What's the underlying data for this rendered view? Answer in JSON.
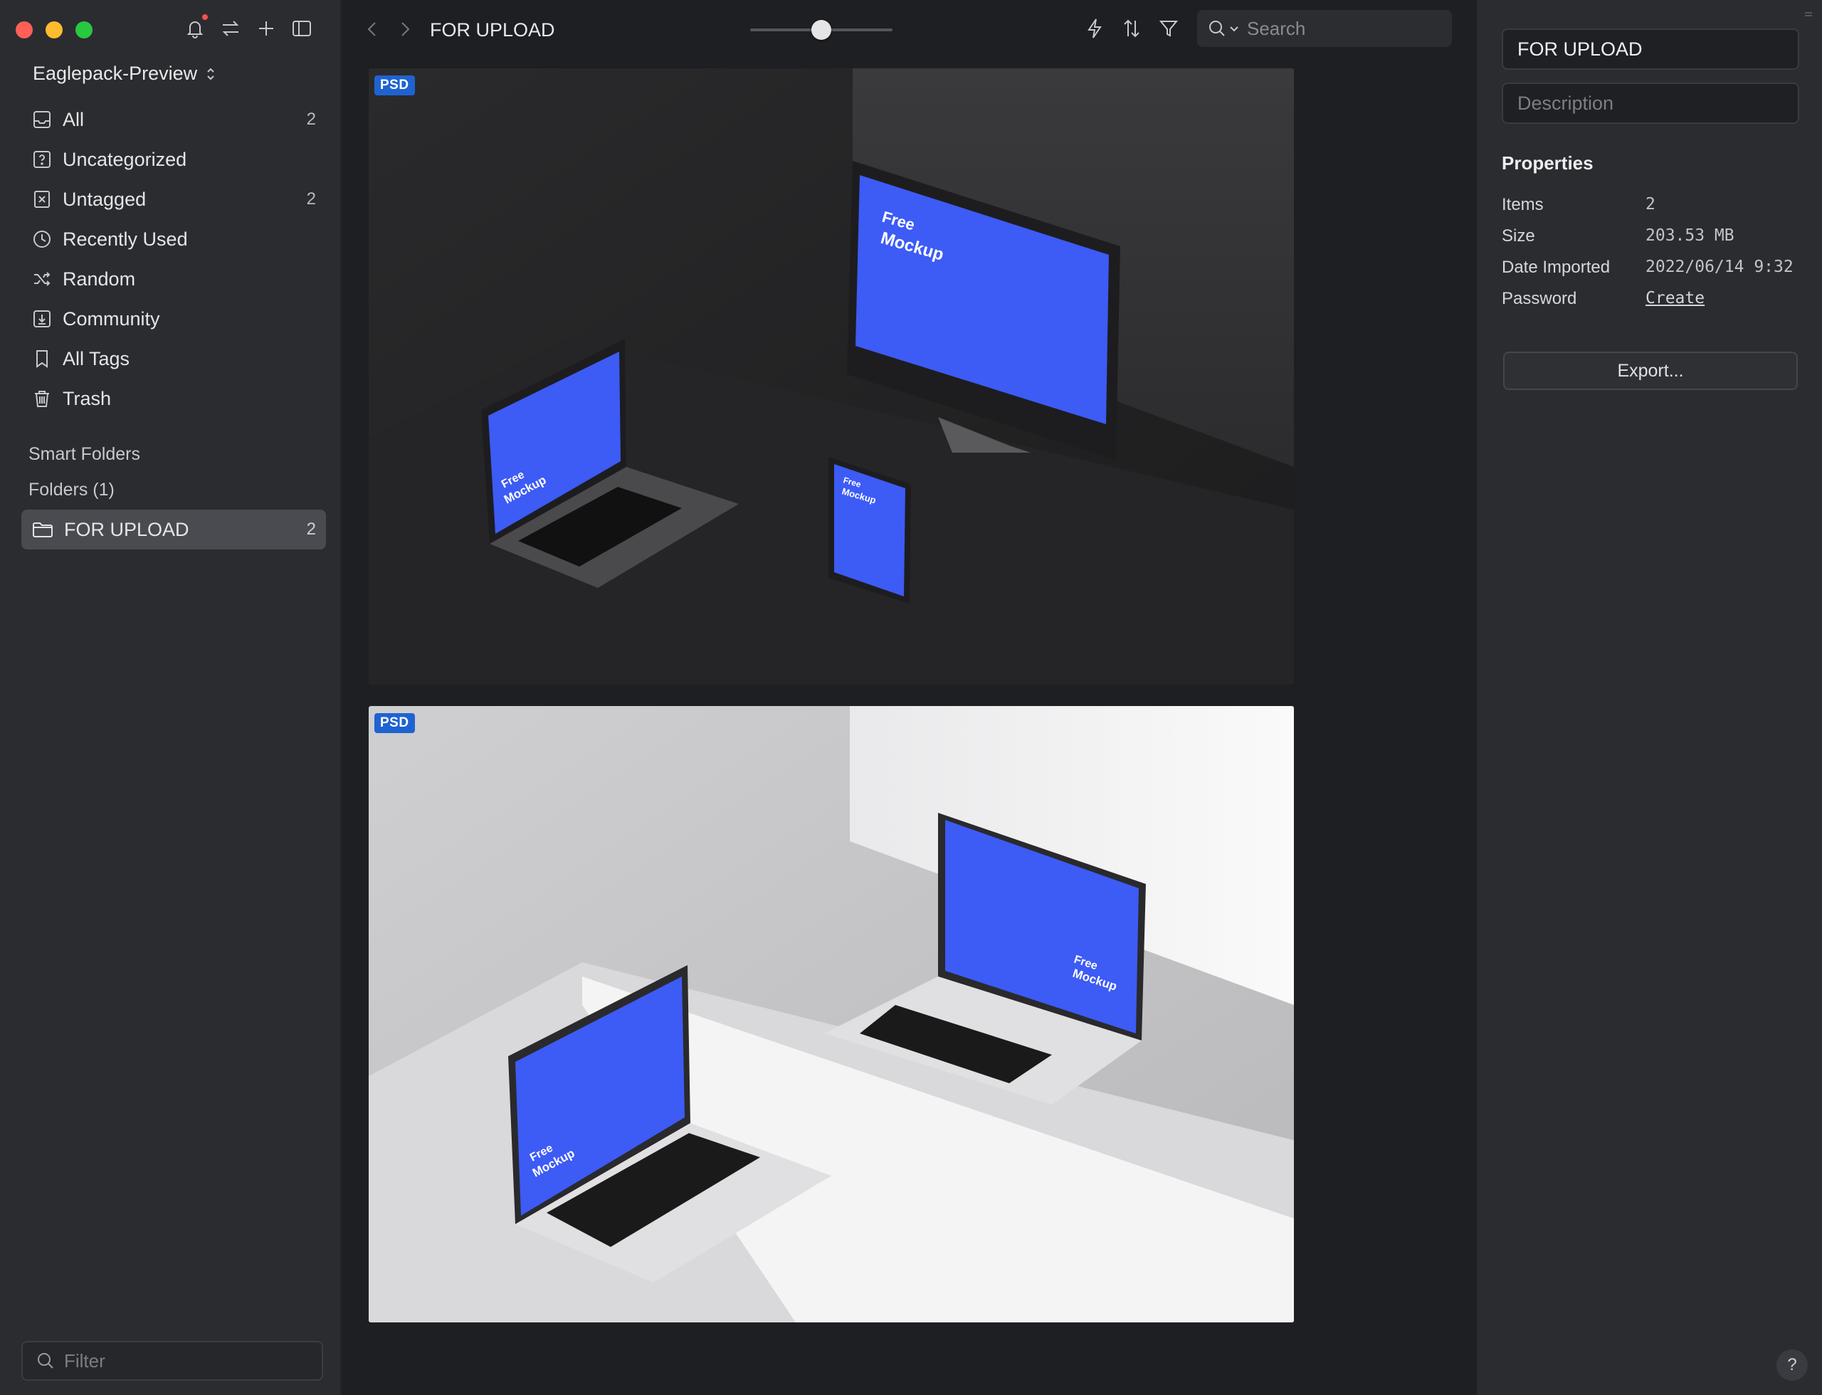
{
  "sidebar": {
    "library": "Eaglepack-Preview",
    "items": [
      {
        "label": "All",
        "count": "2"
      },
      {
        "label": "Uncategorized",
        "count": ""
      },
      {
        "label": "Untagged",
        "count": "2"
      },
      {
        "label": "Recently Used",
        "count": ""
      },
      {
        "label": "Random",
        "count": ""
      },
      {
        "label": "Community",
        "count": ""
      },
      {
        "label": "All Tags",
        "count": ""
      },
      {
        "label": "Trash",
        "count": ""
      }
    ],
    "smart_folders_label": "Smart Folders",
    "folders_label": "Folders (1)",
    "folder": {
      "label": "FOR UPLOAD",
      "count": "2"
    },
    "filter_placeholder": "Filter"
  },
  "toolbar": {
    "breadcrumb": "FOR UPLOAD",
    "zoom_level": 0.5,
    "search_placeholder": "Search"
  },
  "grid": {
    "items": [
      {
        "badge": "PSD",
        "screen_text_1": "Free",
        "screen_text_2": "Mockup"
      },
      {
        "badge": "PSD",
        "screen_text_1": "Free",
        "screen_text_2": "Mockup"
      }
    ]
  },
  "inspector": {
    "name_value": "FOR UPLOAD",
    "description_placeholder": "Description",
    "properties_title": "Properties",
    "properties": [
      {
        "key": "Items",
        "value": "2"
      },
      {
        "key": "Size",
        "value": "203.53 MB"
      },
      {
        "key": "Date Imported",
        "value": "2022/06/14 9:32"
      },
      {
        "key": "Password",
        "value": "Create"
      }
    ],
    "export_label": "Export...",
    "help_label": "?"
  },
  "colors": {
    "accent_blue": "#3d5bf5",
    "badge_blue": "#1f63d1",
    "sidebar_bg": "#2b2c30",
    "main_bg": "#1e1f22"
  }
}
